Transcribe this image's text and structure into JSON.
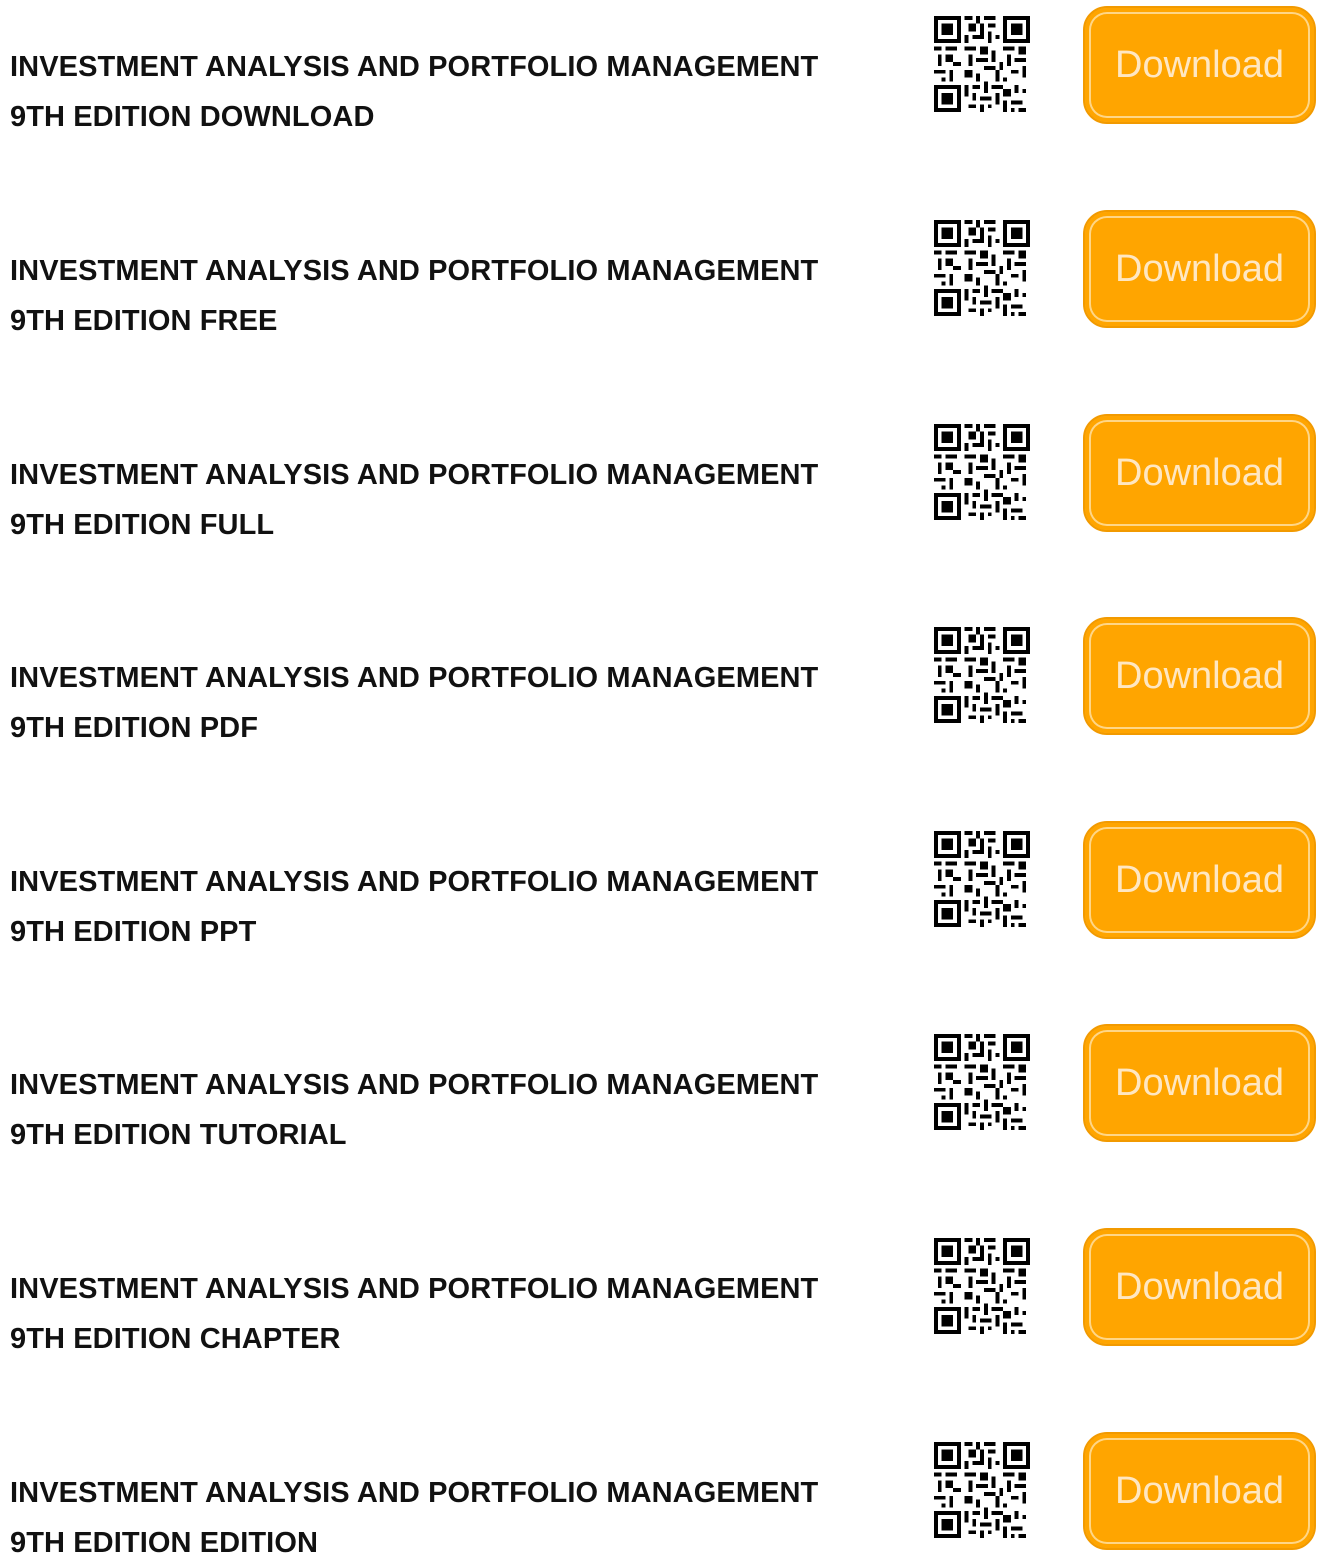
{
  "download_label": "Download",
  "accent_color": "#ffa500",
  "qr_icon": "qr-code-icon",
  "items": [
    {
      "line1": "INVESTMENT ANALYSIS AND PORTFOLIO MANAGEMENT",
      "line2": "9TH EDITION DOWNLOAD"
    },
    {
      "line1": "INVESTMENT ANALYSIS AND PORTFOLIO MANAGEMENT",
      "line2": "9TH EDITION FREE"
    },
    {
      "line1": "INVESTMENT ANALYSIS AND PORTFOLIO MANAGEMENT",
      "line2": "9TH EDITION FULL"
    },
    {
      "line1": "INVESTMENT ANALYSIS AND PORTFOLIO MANAGEMENT",
      "line2": "9TH EDITION PDF"
    },
    {
      "line1": "INVESTMENT ANALYSIS AND PORTFOLIO MANAGEMENT",
      "line2": "9TH EDITION PPT"
    },
    {
      "line1": "INVESTMENT ANALYSIS AND PORTFOLIO MANAGEMENT",
      "line2": "9TH EDITION TUTORIAL"
    },
    {
      "line1": "INVESTMENT ANALYSIS AND PORTFOLIO MANAGEMENT",
      "line2": "9TH EDITION CHAPTER"
    },
    {
      "line1": "INVESTMENT ANALYSIS AND PORTFOLIO MANAGEMENT",
      "line2": "9TH EDITION EDITION"
    }
  ]
}
